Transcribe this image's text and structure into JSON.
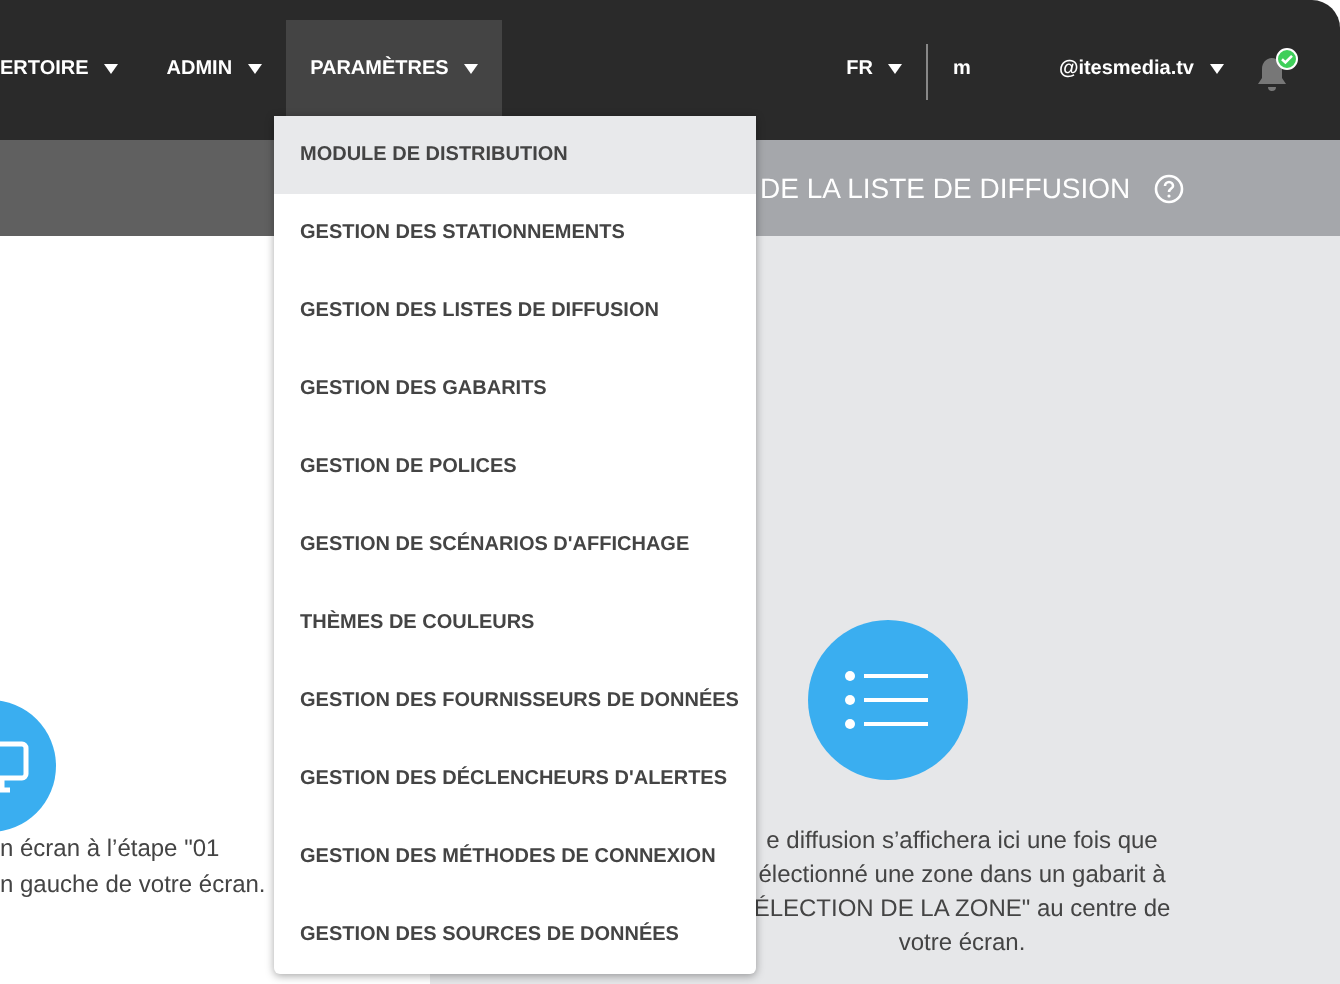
{
  "nav": {
    "items": [
      {
        "label": "ERTOIRE",
        "selected": false
      },
      {
        "label": "ADMIN",
        "selected": false
      },
      {
        "label": "PARAMÈTRES",
        "selected": true
      }
    ],
    "language": "FR",
    "user_initial": "m",
    "account": "@itesmedia.tv",
    "notification_ok": true
  },
  "menu": [
    {
      "label": "MODULE DE DISTRIBUTION",
      "selected": true
    },
    {
      "label": "GESTION DES STATIONNEMENTS",
      "selected": false
    },
    {
      "label": "GESTION DES LISTES DE DIFFUSION",
      "selected": false
    },
    {
      "label": "GESTION DES GABARITS",
      "selected": false
    },
    {
      "label": "GESTION DE POLICES",
      "selected": false
    },
    {
      "label": "GESTION DE SCÉNARIOS D'AFFICHAGE",
      "selected": false
    },
    {
      "label": "THÈMES DE COULEURS",
      "selected": false
    },
    {
      "label": "GESTION DES FOURNISSEURS DE DONNÉES",
      "selected": false
    },
    {
      "label": "GESTION DES DÉCLENCHEURS D'ALERTES",
      "selected": false
    },
    {
      "label": "GESTION DES MÉTHODES DE CONNEXION",
      "selected": false
    },
    {
      "label": "GESTION DES SOURCES DE DONNÉES",
      "selected": false
    }
  ],
  "right_panel": {
    "title": "DE LA LISTE DE DIFFUSION",
    "lines": [
      "e diffusion s’affichera ici une fois que",
      "électionné une zone dans un gabarit à",
      "ÉLECTION DE LA ZONE\" au centre de",
      "votre écran."
    ]
  },
  "left_panel": {
    "lines": [
      "n écran à l’étape \"01",
      "n gauche de votre écran."
    ]
  }
}
